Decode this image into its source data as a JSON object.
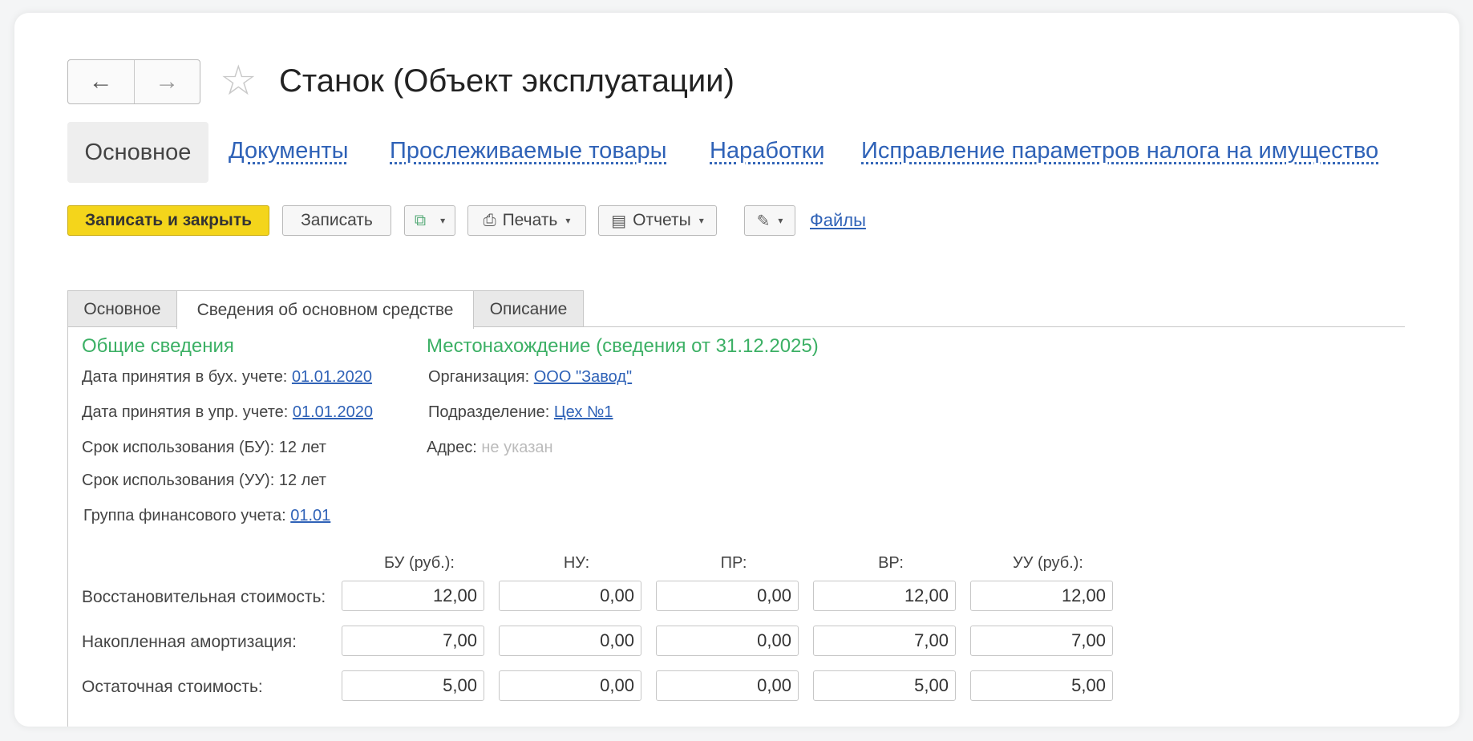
{
  "window": {
    "title": "Станок (Объект эксплуатации)",
    "nav_back": "←",
    "nav_forward": "→",
    "favorite_icon": "star-icon"
  },
  "top_tabs": {
    "active": "Основное",
    "links": [
      "Документы",
      "Прослеживаемые товары",
      "Наработки",
      "Исправление параметров налога на имущество"
    ]
  },
  "toolbar": {
    "save_close": "Записать и закрыть",
    "save": "Записать",
    "print": "Печать",
    "reports": "Отчеты",
    "files": "Файлы"
  },
  "inner_tabs": [
    "Основное",
    "Сведения об основном средстве",
    "Описание"
  ],
  "general": {
    "heading": "Общие сведения",
    "acc_date_label": "Дата принятия в бух. учете:",
    "acc_date": "01.01.2020",
    "mgmt_date_label": "Дата принятия в упр. учете:",
    "mgmt_date": "01.01.2020",
    "term_bu_label": "Срок использования (БУ):",
    "term_bu": "12 лет",
    "term_uu_label": "Срок использования (УУ):",
    "term_uu": "12 лет",
    "fin_group_label": "Группа финансового учета:",
    "fin_group": "01.01"
  },
  "location": {
    "heading": "Местонахождение (сведения от 31.12.2025)",
    "org_label": "Организация:",
    "org": "ООО \"Завод\"",
    "dept_label": "Подразделение:",
    "dept": "Цех №1",
    "address_label": "Адрес:",
    "address": "не указан"
  },
  "values_table": {
    "columns": [
      "БУ (руб.):",
      "НУ:",
      "ПР:",
      "ВР:",
      "УУ (руб.):"
    ],
    "rows": [
      {
        "label": "Восстановительная стоимость:",
        "values": [
          "12,00",
          "0,00",
          "0,00",
          "12,00",
          "12,00"
        ]
      },
      {
        "label": "Накопленная амортизация:",
        "values": [
          "7,00",
          "0,00",
          "0,00",
          "7,00",
          "7,00"
        ]
      },
      {
        "label": "Остаточная стоимость:",
        "values": [
          "5,00",
          "0,00",
          "0,00",
          "5,00",
          "5,00"
        ]
      }
    ]
  },
  "colors": {
    "accent_green": "#3cb065",
    "link_blue": "#2f62b7",
    "primary_yellow": "#f4d51b"
  }
}
